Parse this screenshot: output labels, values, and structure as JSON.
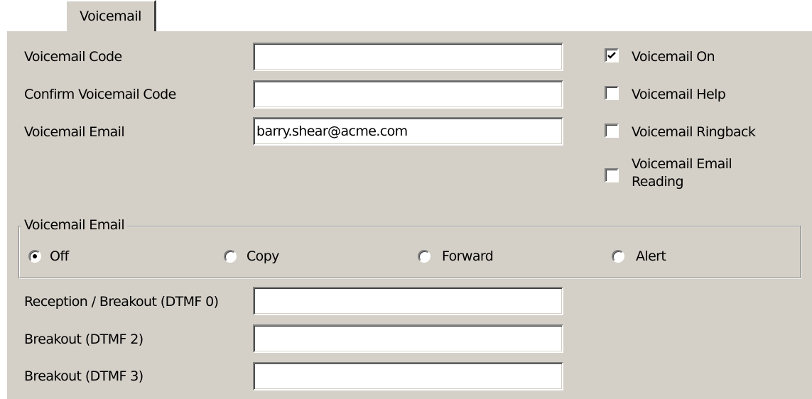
{
  "tab": {
    "label": "Voicemail"
  },
  "fields": {
    "voicemail_code": {
      "label": "Voicemail Code",
      "value": ""
    },
    "confirm_code": {
      "label": "Confirm Voicemail Code",
      "value": ""
    },
    "voicemail_email": {
      "label": "Voicemail Email",
      "value": "barry.shear@acme.com"
    },
    "reception_breakout": {
      "label": "Reception / Breakout (DTMF 0)",
      "value": ""
    },
    "breakout2": {
      "label": "Breakout (DTMF 2)",
      "value": ""
    },
    "breakout3": {
      "label": "Breakout (DTMF 3)",
      "value": ""
    }
  },
  "checkboxes": {
    "voicemail_on": {
      "label": "Voicemail On",
      "checked": true
    },
    "voicemail_help": {
      "label": "Voicemail Help",
      "checked": false
    },
    "voicemail_ringback": {
      "label": "Voicemail Ringback",
      "checked": false
    },
    "voicemail_email_reading": {
      "label_line1": "Voicemail Email",
      "label_line2": "Reading",
      "checked": false
    }
  },
  "email_mode": {
    "legend": "Voicemail Email",
    "options": {
      "off": "Off",
      "copy": "Copy",
      "forward": "Forward",
      "alert": "Alert"
    },
    "selected": "Off"
  },
  "colors": {
    "panel": "#d4d0c8",
    "field": "#ffffff"
  }
}
